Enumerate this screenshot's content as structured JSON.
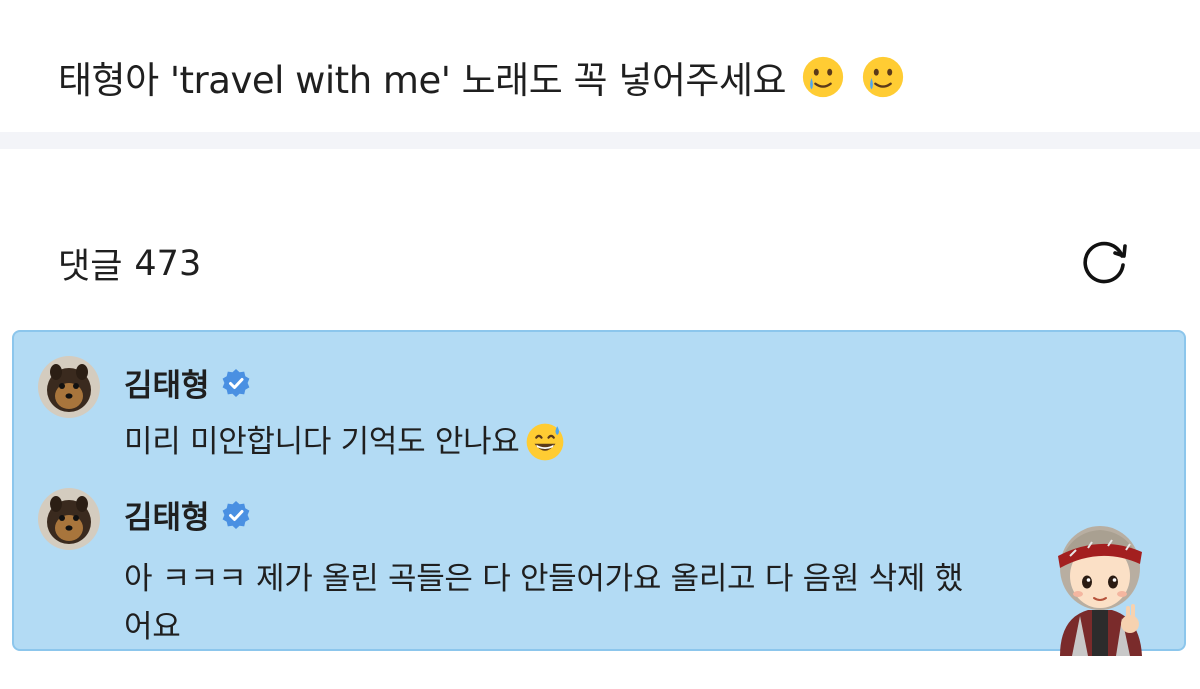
{
  "post": {
    "text": "태형아 'travel with me' 노래도 꼭 넣어주세요",
    "emoji": "smiling-face-with-tear"
  },
  "comments_section": {
    "label": "댓글",
    "count": "473",
    "refresh_icon": "refresh-icon"
  },
  "highlight": {
    "background": "#b3dbf4",
    "border": "#8cc6ec"
  },
  "comments": [
    {
      "author": "김태형",
      "verified": true,
      "text": "미리 미안합니다 기억도 안나요",
      "emoji": "grinning-face-with-sweat"
    },
    {
      "author": "김태형",
      "verified": true,
      "text": "아 ㅋㅋㅋ 제가 올린 곡들은 다 안들어가요 올리고 다 음원 삭제 했어요"
    }
  ],
  "colors": {
    "verified": "#4a90e2",
    "text": "#1f1f1f"
  }
}
